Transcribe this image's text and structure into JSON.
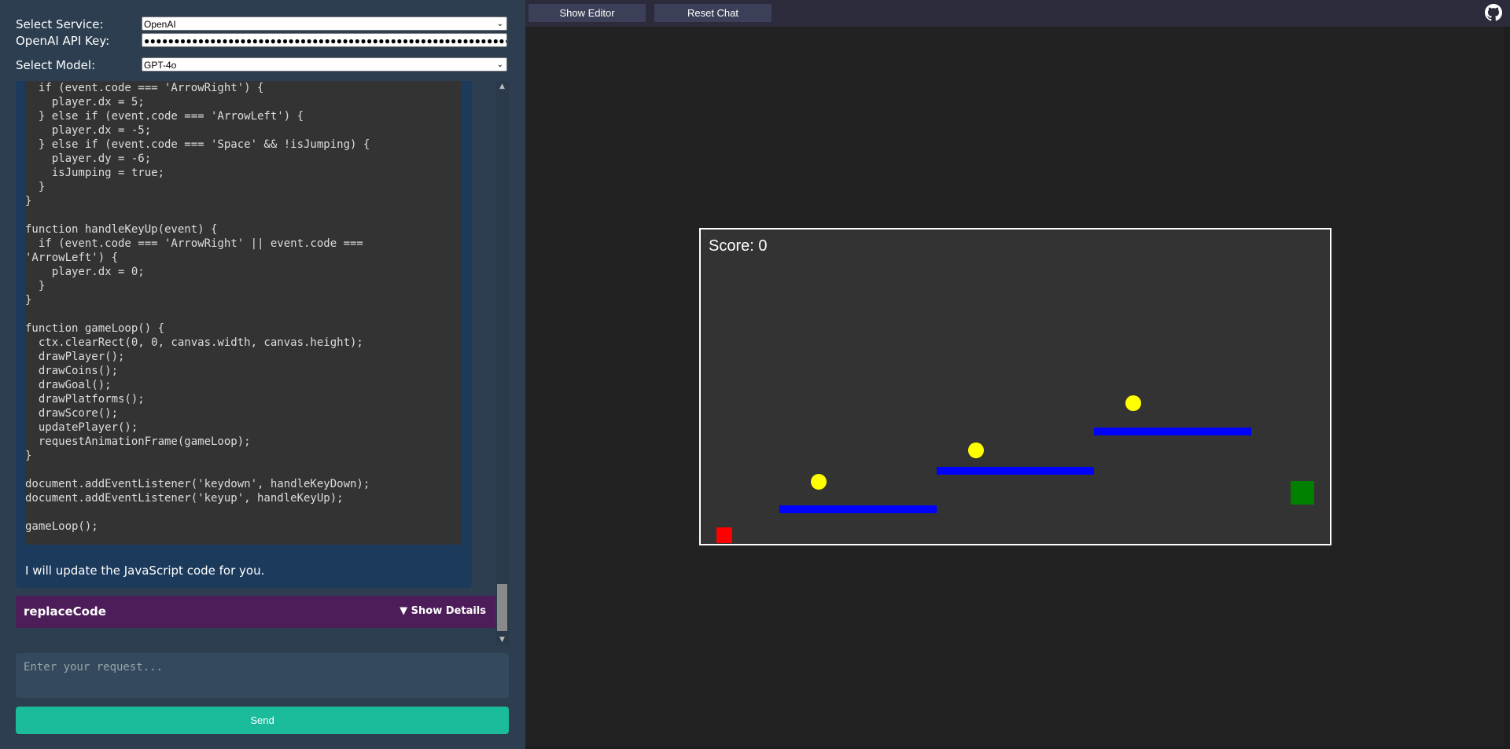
{
  "settings": {
    "service_label": "Select Service:",
    "service_value": "OpenAI",
    "api_key_label": "OpenAI API Key:",
    "api_key_value": "●●●●●●●●●●●●●●●●●●●●●●●●●●●●●●●●●●●●●●●●●●●●●●●●●●●●●●●●●●●●●●●●●●●●●●●●●●●●",
    "model_label": "Select Model:",
    "model_value": "GPT-4o"
  },
  "chat": {
    "code_lines": [
      "  if (event.code === 'ArrowRight') {",
      "    player.dx = 5;",
      "  } else if (event.code === 'ArrowLeft') {",
      "    player.dx = -5;",
      "  } else if (event.code === 'Space' && !isJumping) {",
      "    player.dy = -6;",
      "    isJumping = true;",
      "  }",
      "}",
      "",
      "function handleKeyUp(event) {",
      "  if (event.code === 'ArrowRight' || event.code ===",
      "'ArrowLeft') {",
      "    player.dx = 0;",
      "  }",
      "}",
      "",
      "function gameLoop() {",
      "  ctx.clearRect(0, 0, canvas.width, canvas.height);",
      "  drawPlayer();",
      "  drawCoins();",
      "  drawGoal();",
      "  drawPlatforms();",
      "  drawScore();",
      "  updatePlayer();",
      "  requestAnimationFrame(gameLoop);",
      "}",
      "",
      "document.addEventListener('keydown', handleKeyDown);",
      "document.addEventListener('keyup', handleKeyUp);",
      "",
      "gameLoop();"
    ],
    "message_text": "I will update the JavaScript code for you.",
    "tool_name": "replaceCode",
    "tool_toggle": "▼ Show Details"
  },
  "input": {
    "placeholder": "Enter your request...",
    "send_label": "Send"
  },
  "topbar": {
    "show_editor": "Show Editor",
    "reset_chat": "Reset Chat"
  },
  "game": {
    "score_text": "Score: 0",
    "colors": {
      "platform": "#0000ff",
      "coin": "#ffff00",
      "player": "#ff0000",
      "goal": "#008000"
    }
  }
}
